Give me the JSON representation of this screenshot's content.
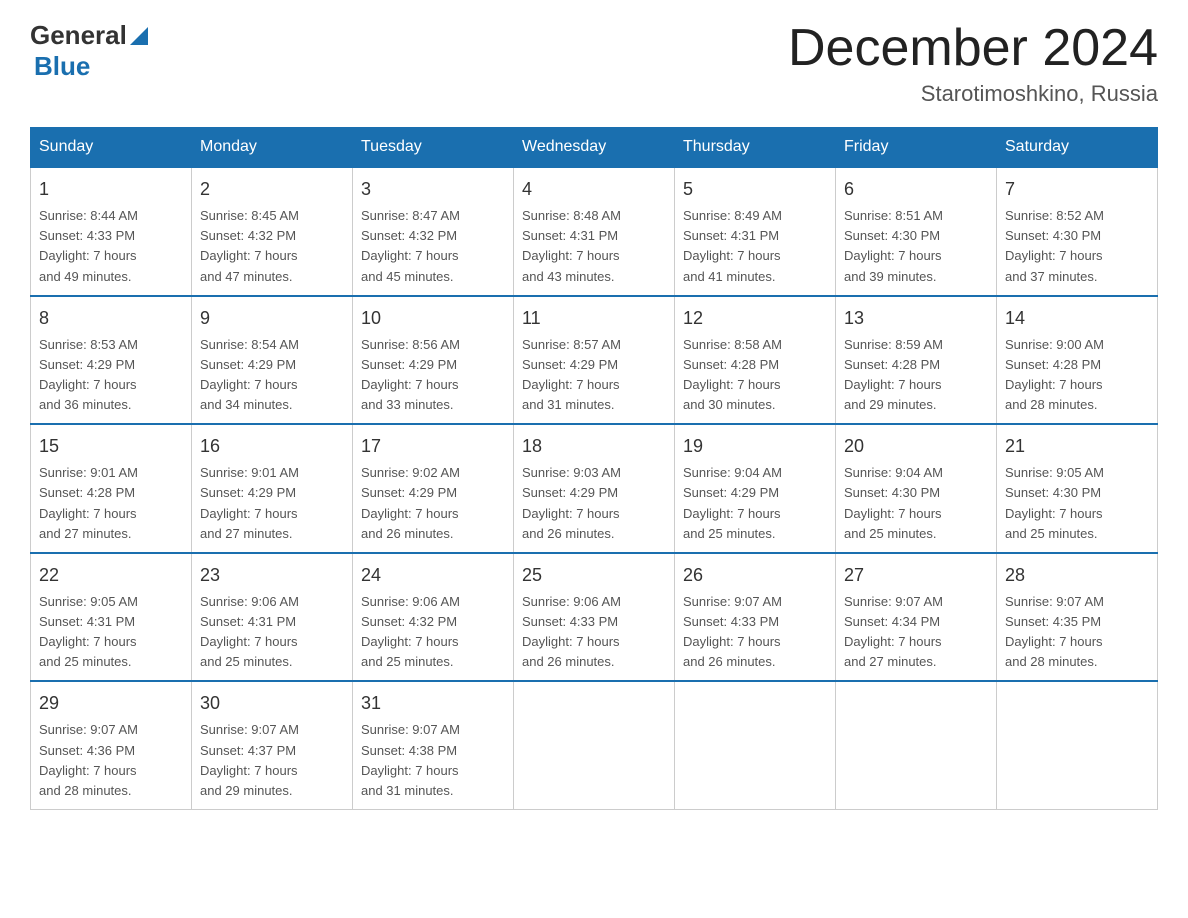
{
  "header": {
    "logo_general": "General",
    "logo_blue": "Blue",
    "month_title": "December 2024",
    "location": "Starotimoshkino, Russia"
  },
  "days_of_week": [
    "Sunday",
    "Monday",
    "Tuesday",
    "Wednesday",
    "Thursday",
    "Friday",
    "Saturday"
  ],
  "weeks": [
    [
      {
        "day": "1",
        "info": "Sunrise: 8:44 AM\nSunset: 4:33 PM\nDaylight: 7 hours\nand 49 minutes."
      },
      {
        "day": "2",
        "info": "Sunrise: 8:45 AM\nSunset: 4:32 PM\nDaylight: 7 hours\nand 47 minutes."
      },
      {
        "day": "3",
        "info": "Sunrise: 8:47 AM\nSunset: 4:32 PM\nDaylight: 7 hours\nand 45 minutes."
      },
      {
        "day": "4",
        "info": "Sunrise: 8:48 AM\nSunset: 4:31 PM\nDaylight: 7 hours\nand 43 minutes."
      },
      {
        "day": "5",
        "info": "Sunrise: 8:49 AM\nSunset: 4:31 PM\nDaylight: 7 hours\nand 41 minutes."
      },
      {
        "day": "6",
        "info": "Sunrise: 8:51 AM\nSunset: 4:30 PM\nDaylight: 7 hours\nand 39 minutes."
      },
      {
        "day": "7",
        "info": "Sunrise: 8:52 AM\nSunset: 4:30 PM\nDaylight: 7 hours\nand 37 minutes."
      }
    ],
    [
      {
        "day": "8",
        "info": "Sunrise: 8:53 AM\nSunset: 4:29 PM\nDaylight: 7 hours\nand 36 minutes."
      },
      {
        "day": "9",
        "info": "Sunrise: 8:54 AM\nSunset: 4:29 PM\nDaylight: 7 hours\nand 34 minutes."
      },
      {
        "day": "10",
        "info": "Sunrise: 8:56 AM\nSunset: 4:29 PM\nDaylight: 7 hours\nand 33 minutes."
      },
      {
        "day": "11",
        "info": "Sunrise: 8:57 AM\nSunset: 4:29 PM\nDaylight: 7 hours\nand 31 minutes."
      },
      {
        "day": "12",
        "info": "Sunrise: 8:58 AM\nSunset: 4:28 PM\nDaylight: 7 hours\nand 30 minutes."
      },
      {
        "day": "13",
        "info": "Sunrise: 8:59 AM\nSunset: 4:28 PM\nDaylight: 7 hours\nand 29 minutes."
      },
      {
        "day": "14",
        "info": "Sunrise: 9:00 AM\nSunset: 4:28 PM\nDaylight: 7 hours\nand 28 minutes."
      }
    ],
    [
      {
        "day": "15",
        "info": "Sunrise: 9:01 AM\nSunset: 4:28 PM\nDaylight: 7 hours\nand 27 minutes."
      },
      {
        "day": "16",
        "info": "Sunrise: 9:01 AM\nSunset: 4:29 PM\nDaylight: 7 hours\nand 27 minutes."
      },
      {
        "day": "17",
        "info": "Sunrise: 9:02 AM\nSunset: 4:29 PM\nDaylight: 7 hours\nand 26 minutes."
      },
      {
        "day": "18",
        "info": "Sunrise: 9:03 AM\nSunset: 4:29 PM\nDaylight: 7 hours\nand 26 minutes."
      },
      {
        "day": "19",
        "info": "Sunrise: 9:04 AM\nSunset: 4:29 PM\nDaylight: 7 hours\nand 25 minutes."
      },
      {
        "day": "20",
        "info": "Sunrise: 9:04 AM\nSunset: 4:30 PM\nDaylight: 7 hours\nand 25 minutes."
      },
      {
        "day": "21",
        "info": "Sunrise: 9:05 AM\nSunset: 4:30 PM\nDaylight: 7 hours\nand 25 minutes."
      }
    ],
    [
      {
        "day": "22",
        "info": "Sunrise: 9:05 AM\nSunset: 4:31 PM\nDaylight: 7 hours\nand 25 minutes."
      },
      {
        "day": "23",
        "info": "Sunrise: 9:06 AM\nSunset: 4:31 PM\nDaylight: 7 hours\nand 25 minutes."
      },
      {
        "day": "24",
        "info": "Sunrise: 9:06 AM\nSunset: 4:32 PM\nDaylight: 7 hours\nand 25 minutes."
      },
      {
        "day": "25",
        "info": "Sunrise: 9:06 AM\nSunset: 4:33 PM\nDaylight: 7 hours\nand 26 minutes."
      },
      {
        "day": "26",
        "info": "Sunrise: 9:07 AM\nSunset: 4:33 PM\nDaylight: 7 hours\nand 26 minutes."
      },
      {
        "day": "27",
        "info": "Sunrise: 9:07 AM\nSunset: 4:34 PM\nDaylight: 7 hours\nand 27 minutes."
      },
      {
        "day": "28",
        "info": "Sunrise: 9:07 AM\nSunset: 4:35 PM\nDaylight: 7 hours\nand 28 minutes."
      }
    ],
    [
      {
        "day": "29",
        "info": "Sunrise: 9:07 AM\nSunset: 4:36 PM\nDaylight: 7 hours\nand 28 minutes."
      },
      {
        "day": "30",
        "info": "Sunrise: 9:07 AM\nSunset: 4:37 PM\nDaylight: 7 hours\nand 29 minutes."
      },
      {
        "day": "31",
        "info": "Sunrise: 9:07 AM\nSunset: 4:38 PM\nDaylight: 7 hours\nand 31 minutes."
      },
      {
        "day": "",
        "info": ""
      },
      {
        "day": "",
        "info": ""
      },
      {
        "day": "",
        "info": ""
      },
      {
        "day": "",
        "info": ""
      }
    ]
  ]
}
